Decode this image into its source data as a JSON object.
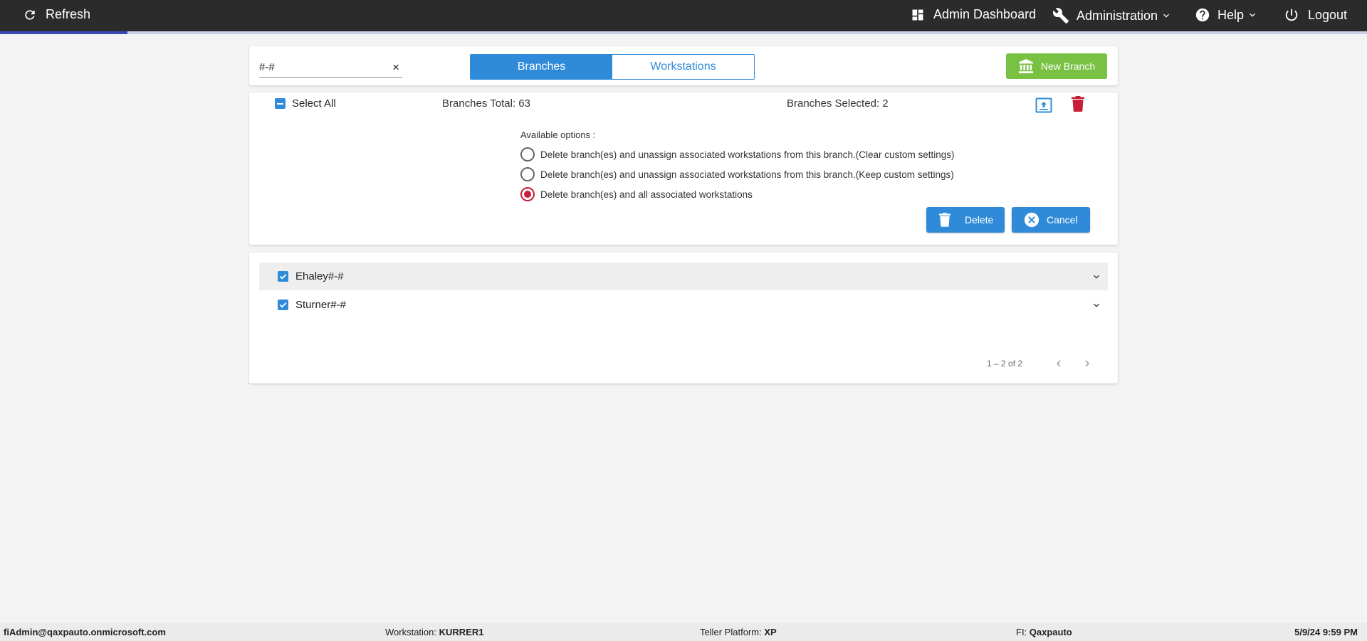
{
  "topbar": {
    "refresh_label": "Refresh",
    "admin_dashboard_label": "Admin Dashboard",
    "administration_label": "Administration",
    "help_label": "Help",
    "logout_label": "Logout",
    "progress": 0.093
  },
  "search": {
    "value": "#-#",
    "clear_glyph": "×"
  },
  "view_toggle": {
    "branches_label": "Branches",
    "workstations_label": "Workstations",
    "active": "Branches"
  },
  "new_branch_label": "New Branch",
  "selection": {
    "select_all_label": "Select All",
    "branches_total": "Branches Total: 63",
    "branches_selected": "Branches Selected: 2"
  },
  "delete_panel": {
    "title": "Available options :",
    "options": [
      {
        "label": "Delete branch(es) and unassign associated workstations from this branch.(Clear custom settings)",
        "checked": false
      },
      {
        "label": "Delete branch(es) and unassign associated workstations from this branch.(Keep custom settings)",
        "checked": false
      },
      {
        "label": "Delete branch(es) and all associated workstations",
        "checked": true
      }
    ],
    "delete_label": "Delete",
    "cancel_label": "Cancel"
  },
  "branches": [
    {
      "name": "Ehaley#-#",
      "checked": true
    },
    {
      "name": "Sturner#-#",
      "checked": true
    }
  ],
  "pagination": {
    "text": "1 – 2 of 2"
  },
  "footer": {
    "user": "fiAdmin@qaxpauto.onmicrosoft.com",
    "workstation_label": "Workstation:",
    "workstation_value": "KURRER1",
    "teller_platform_label": "Teller Platform:",
    "teller_platform_value": "XP",
    "fi_label": "FI:",
    "fi_value": "Qaxpauto",
    "datetime": "5/9/24 9:59 PM"
  },
  "colors": {
    "primary": "#2f8bd9",
    "success": "#79c142",
    "danger": "#c81e3a",
    "topbar": "#2b2b2b"
  },
  "icons": {
    "refresh": "refresh-icon",
    "dashboard": "dashboard-icon",
    "wrench": "wrench-icon",
    "help": "help-icon",
    "power": "power-icon",
    "bank": "bank-icon",
    "upload": "upload-icon",
    "trash": "trash-icon",
    "cancel": "cancel-circle-icon"
  }
}
